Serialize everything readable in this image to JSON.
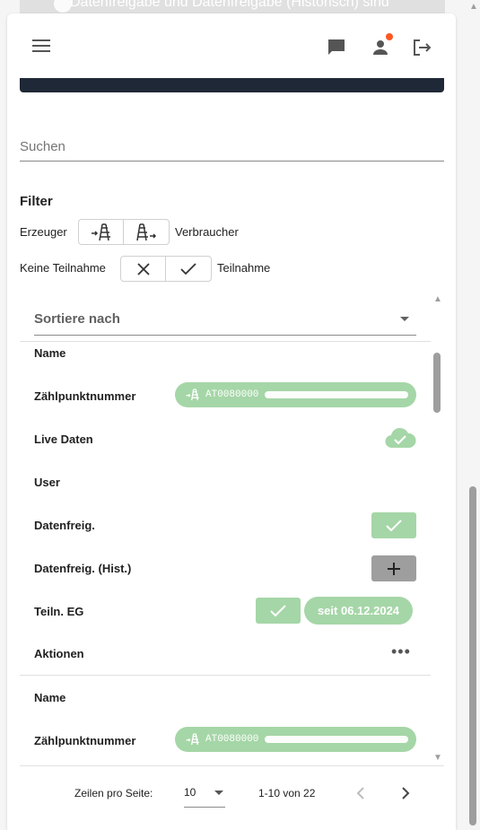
{
  "banner": {
    "text": "Datenfreigabe und Datenfreigabe (Historisch) sind"
  },
  "appbar": {
    "menu_icon": "hamburger-menu-icon",
    "chat_icon": "chat-icon",
    "user_icon": "account-icon",
    "logout_icon": "logout-icon",
    "notification_color": "#ff5722"
  },
  "search": {
    "placeholder": "Suchen",
    "value": ""
  },
  "filter": {
    "title": "Filter",
    "producer_label": "Erzeuger",
    "consumer_label": "Verbraucher",
    "no_participation_label": "Keine Teilnahme",
    "participation_label": "Teilnahme"
  },
  "sort": {
    "label": "Sortiere nach"
  },
  "record1": {
    "name_label": "Name",
    "meter_label": "Zählpunktnummer",
    "meter_value": "AT0080000",
    "live_label": "Live Daten",
    "user_label": "User",
    "release_label": "Datenfreig.",
    "release_hist_label": "Datenfreig. (Hist.)",
    "participation_label": "Teiln. EG",
    "participation_since": "seit 06.12.2024",
    "actions_label": "Aktionen",
    "actions_icon": "more-horizontal-icon"
  },
  "record2": {
    "name_label": "Name",
    "meter_label": "Zählpunktnummer",
    "meter_value": "AT0080000"
  },
  "pager": {
    "rows_per_page_label": "Zeilen pro Seite:",
    "rows_per_page_value": "10",
    "range": "1-10 von 22",
    "prev_icon": "chevron-left-icon",
    "next_icon": "chevron-right-icon"
  },
  "colors": {
    "accent_green": "#a5d6a7",
    "header_dark": "#1f2836",
    "grey_button": "#9e9e9e"
  }
}
